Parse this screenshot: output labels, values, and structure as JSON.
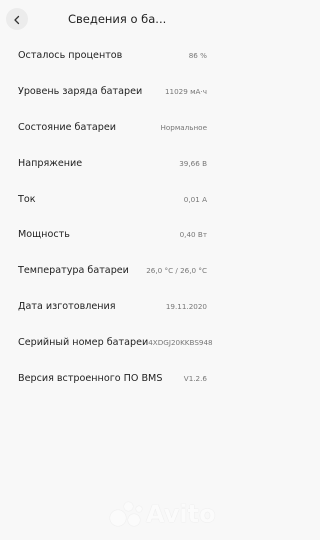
{
  "header": {
    "title": "Сведения о ба..."
  },
  "rows": [
    {
      "label": "Осталось процентов",
      "value": "86 %"
    },
    {
      "label": "Уровень заряда батареи",
      "value": "11029 мА·ч"
    },
    {
      "label": "Состояние батареи",
      "value": "Нормальное"
    },
    {
      "label": "Напряжение",
      "value": "39,66 В"
    },
    {
      "label": "Ток",
      "value": "0,01 А"
    },
    {
      "label": "Мощность",
      "value": "0,40 Вт"
    },
    {
      "label": "Температура батареи",
      "value": "26,0 °C / 26,0 °C"
    },
    {
      "label": "Дата изготовления",
      "value": "19.11.2020"
    },
    {
      "label": "Серийный номер батареи",
      "value": "4XDGJ20KKBS948"
    },
    {
      "label": "Версия встроенного ПО BMS",
      "value": "V1.2.6"
    }
  ],
  "watermark": {
    "text": "Avito"
  },
  "icons": {
    "back": "chevron-left-icon"
  }
}
